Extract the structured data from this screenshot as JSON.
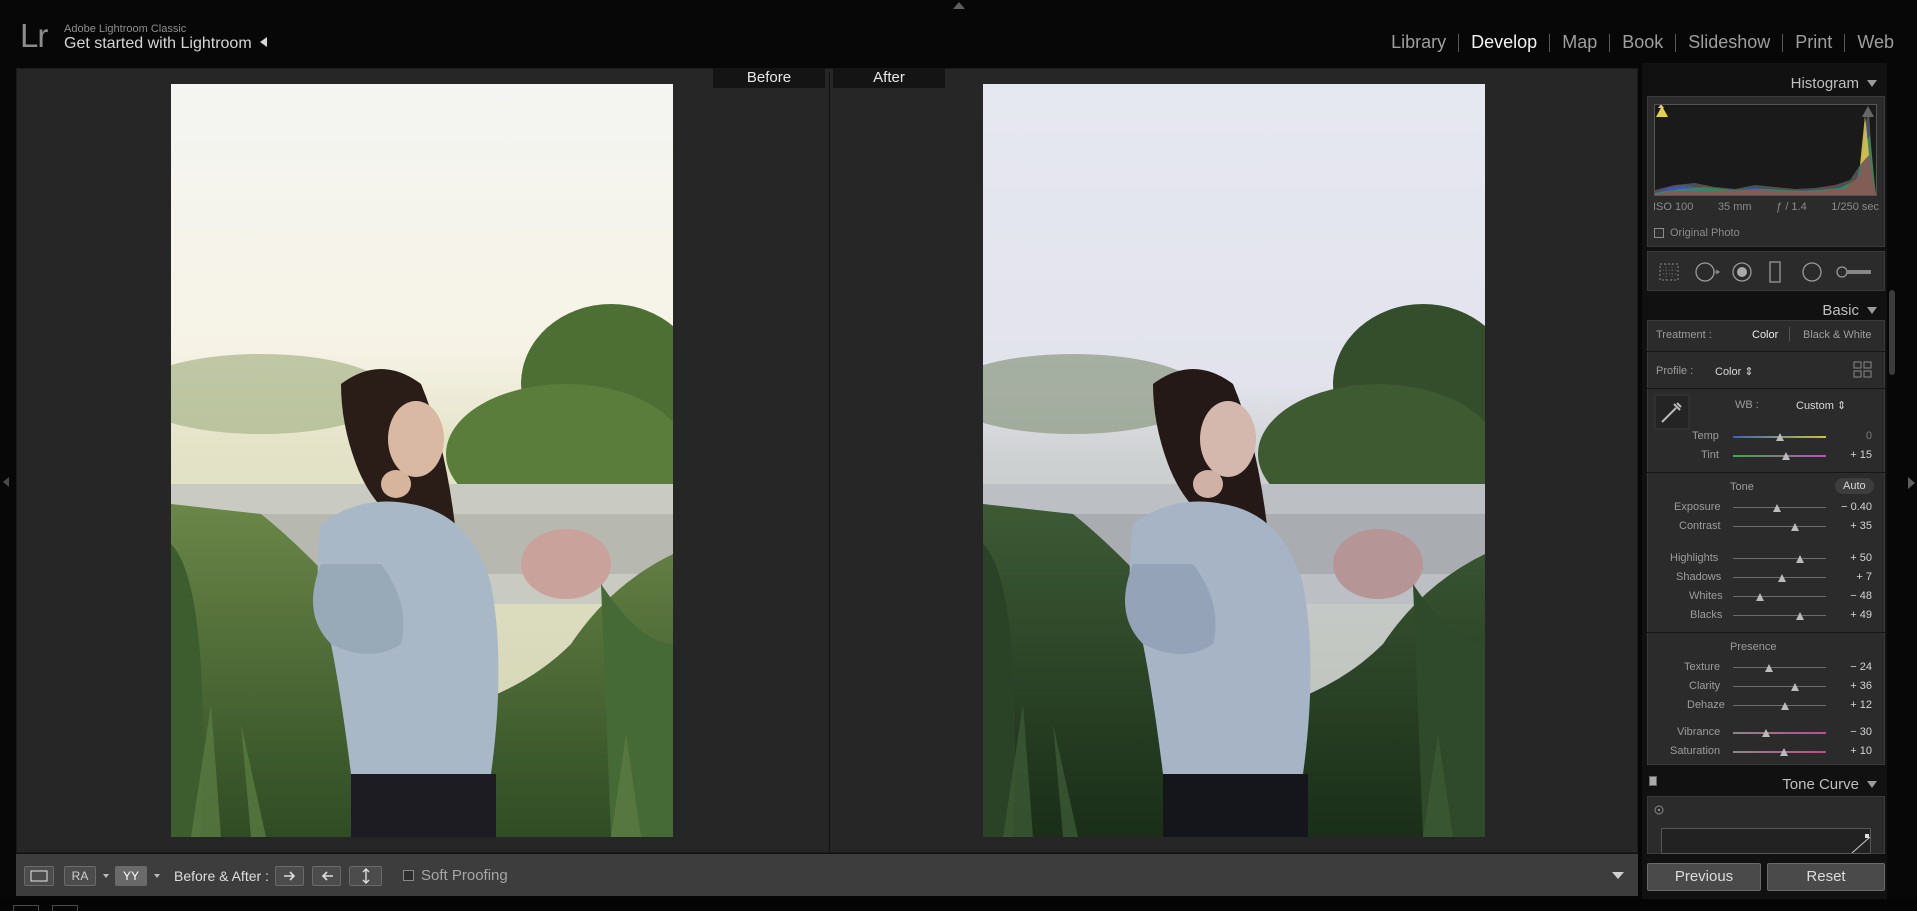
{
  "header": {
    "logo": "Lr",
    "app_name": "Adobe Lightroom Classic",
    "identity_plate": "Get started with Lightroom"
  },
  "modules": [
    "Library",
    "Develop",
    "Map",
    "Book",
    "Slideshow",
    "Print",
    "Web"
  ],
  "active_module": "Develop",
  "view": {
    "before_label": "Before",
    "after_label": "After"
  },
  "toolbar": {
    "before_after_label": "Before & After :",
    "soft_proofing_label": "Soft Proofing",
    "view_ra": "RA",
    "view_yy": "YY"
  },
  "histogram": {
    "title": "Histogram",
    "iso": "ISO 100",
    "focal": "35 mm",
    "aperture": "ƒ / 1.4",
    "shutter": "1/250 sec",
    "original_photo": "Original Photo"
  },
  "basic": {
    "title": "Basic",
    "treatment_label": "Treatment :",
    "treatment_color": "Color",
    "treatment_bw": "Black & White",
    "profile_label": "Profile :",
    "profile_value": "Color",
    "wb_label": "WB :",
    "wb_value": "Custom",
    "tone_label": "Tone",
    "auto_label": "Auto",
    "presence_label": "Presence",
    "sliders": {
      "temp": {
        "label": "Temp",
        "value": "0",
        "pos": 0.5
      },
      "tint": {
        "label": "Tint",
        "value": "+ 15",
        "pos": 0.57
      },
      "exposure": {
        "label": "Exposure",
        "value": "− 0.40",
        "pos": 0.47
      },
      "contrast": {
        "label": "Contrast",
        "value": "+ 35",
        "pos": 0.67
      },
      "highlights": {
        "label": "Highlights",
        "value": "+ 50",
        "pos": 0.72
      },
      "shadows": {
        "label": "Shadows",
        "value": "+ 7",
        "pos": 0.53
      },
      "whites": {
        "label": "Whites",
        "value": "− 48",
        "pos": 0.29
      },
      "blacks": {
        "label": "Blacks",
        "value": "+ 49",
        "pos": 0.72
      },
      "texture": {
        "label": "Texture",
        "value": "− 24",
        "pos": 0.39
      },
      "clarity": {
        "label": "Clarity",
        "value": "+ 36",
        "pos": 0.67
      },
      "dehaze": {
        "label": "Dehaze",
        "value": "+ 12",
        "pos": 0.56
      },
      "vibrance": {
        "label": "Vibrance",
        "value": "− 30",
        "pos": 0.36
      },
      "saturation": {
        "label": "Saturation",
        "value": "+ 10",
        "pos": 0.55
      }
    }
  },
  "tone_curve": {
    "title": "Tone Curve"
  },
  "buttons": {
    "previous": "Previous",
    "reset": "Reset"
  },
  "icons": {
    "crop": "crop-overlay-icon",
    "spot": "spot-removal-icon",
    "redeye": "red-eye-icon",
    "graduated": "graduated-filter-icon",
    "radial": "radial-filter-icon",
    "brush": "adjustment-brush-icon",
    "eyedropper": "white-balance-selector-icon"
  },
  "colors": {
    "background": "#070707",
    "workspace": "#262626",
    "panel": "#2b2b2b",
    "toolbar": "#3d3d3d",
    "active_text": "#f2f2f2"
  }
}
